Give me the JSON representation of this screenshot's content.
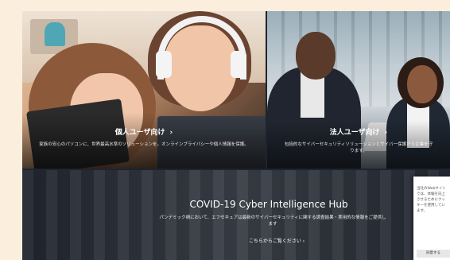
{
  "consumer": {
    "title": "個人ユーザ向け",
    "arrow": "›",
    "description": "家族の安心のパソコンに、世界最高水準のソリューションを。オンラインプライバシーや個人情報を保護。"
  },
  "business": {
    "title": "法人ユーザ向け",
    "arrow": "›",
    "description": "包括的なサイバーセキュリティソリューションとサイバー保護から企業を守ります。"
  },
  "banner": {
    "title": "COVID-19 Cyber Intelligence Hub",
    "description": "パンデミック禍において、エフセキュアは最新のサイバーセキュリティに関する調査結果・実用的な情報をご提供します",
    "link_label": "こちらからご覧ください",
    "link_arrow": "›"
  },
  "popup": {
    "text": "当社のWebサイトでは、体験を向上させるためにクッキーを使用しています。",
    "button_label": "同意する"
  }
}
